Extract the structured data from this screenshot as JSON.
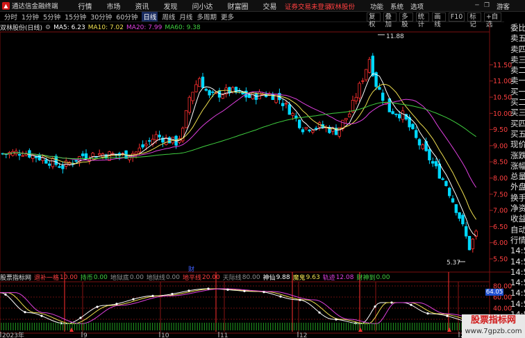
{
  "titlebar": {
    "app_name": "通达信金融终端",
    "menus": [
      "行情",
      "市场",
      "资讯",
      "发现",
      "问小达",
      "财富圈",
      "交易"
    ],
    "login_status": "证券交易未登录",
    "stock_name": "双林股份",
    "right_menus": [
      "功能",
      "系统",
      "选项"
    ],
    "guest": "游客"
  },
  "periodbar": {
    "periods": [
      "分时",
      "1分钟",
      "5分钟",
      "15分钟",
      "30分钟",
      "60分钟",
      "日线",
      "周线",
      "月线",
      "多周期",
      "更多"
    ],
    "active_period": "日线",
    "tools": [
      "复权",
      "叠加",
      "多股",
      "统计",
      "画线",
      "F10",
      "标记",
      "+自选"
    ]
  },
  "mainfo": {
    "stock": "双林股份(日线)",
    "ma5": "MA5: 6.23",
    "ma10": "MA10: 7.02",
    "ma20": "MA20: 7.99",
    "ma60": "MA60: 9.38",
    "colors": {
      "ma5": "#ffffff",
      "ma10": "#f0e050",
      "ma20": "#e040e0",
      "ma60": "#40d040"
    }
  },
  "chart_data": {
    "type": "candlestick",
    "price_axis_ticks": [
      "11.50",
      "11.00",
      "10.50",
      "10.00",
      "9.50",
      "9.00",
      "8.50",
      "8.00",
      "7.50",
      "7.00",
      "6.50",
      "6.00",
      "5.50"
    ],
    "price_range": [
      5.3,
      12.0
    ],
    "max_label": "11.88",
    "min_label": "5.37",
    "event_marker": "财",
    "indicator_axis_ticks": [
      "80.00",
      "60.00",
      "40.00",
      "20.00"
    ],
    "indicator_value_label": "64.05",
    "date_labels": [
      "2023年",
      "9",
      "10",
      "11",
      "12",
      "2024年"
    ],
    "up_color": "#ff3030",
    "down_color": "#00d8ff"
  },
  "indicator": {
    "name": "股票指标网",
    "items": [
      {
        "label": "退补一格",
        "value": "10.00",
        "color": "#ff4040"
      },
      {
        "label": "持币",
        "value": "0.00",
        "color": "#40d040"
      },
      {
        "label": "地狱底",
        "value": "0.00",
        "color": "#909090"
      },
      {
        "label": "地狱线",
        "value": "0.00",
        "color": "#909090"
      },
      {
        "label": "地平线",
        "value": "20.00",
        "color": "#ff4040"
      },
      {
        "label": "天际线",
        "value": "80.00",
        "color": "#909090"
      },
      {
        "label": "神仙",
        "value": "9.88",
        "color": "#ffffff"
      },
      {
        "label": "魔鬼",
        "value": "9.63",
        "color": "#f0e050"
      },
      {
        "label": "轨迹",
        "value": "12.08",
        "color": "#e040e0"
      },
      {
        "label": "财神到",
        "value": "0.00",
        "color": "#40d040"
      }
    ]
  },
  "sidelist": [
    "委比",
    "卖五",
    "卖四",
    "卖三",
    "卖二",
    "卖一",
    "买一",
    "买二",
    "买三",
    "买四",
    "买五",
    "现价",
    "涨跌",
    "涨幅",
    "总量",
    "外盘",
    "换手",
    "净资",
    "收益",
    "自动",
    "行情",
    "14:50",
    "14:50",
    "14:50",
    "14:50",
    "14:50",
    "14:50",
    "14:50",
    "14:50",
    "14:50",
    "14:50"
  ],
  "watermark": {
    "line1": "股票指标网",
    "line2": "www.7gpzb.com"
  }
}
